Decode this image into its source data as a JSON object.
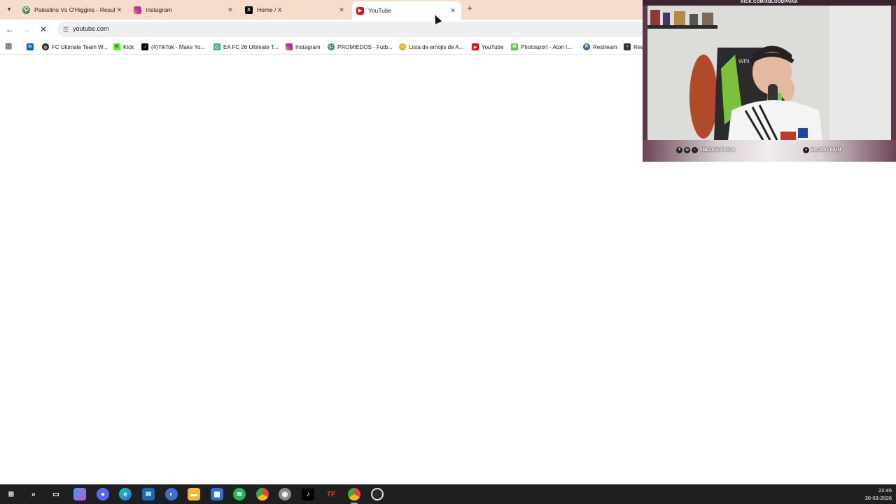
{
  "colors": {
    "tabstrip_bg": "#f7dccc",
    "taskbar_bg": "#1f1f1f",
    "accent": "#60aaff"
  },
  "tabs": [
    {
      "title": "Palestino Vs O'Higgins - Resulta",
      "icon": "soccer-ball-icon",
      "active": false
    },
    {
      "title": "Instagram",
      "icon": "instagram-icon",
      "active": false
    },
    {
      "title": "Home / X",
      "icon": "x-logo-icon",
      "active": false
    },
    {
      "title": "YouTube",
      "icon": "youtube-icon",
      "active": true
    }
  ],
  "tab_close_glyph": "✕",
  "new_tab_glyph": "+",
  "address": {
    "url": "youtube.com"
  },
  "bookmarks": [
    {
      "label": "",
      "icon": "linkedin-icon"
    },
    {
      "label": "FC Ultimate Team W...",
      "icon": "fc-icon"
    },
    {
      "label": "Kick",
      "icon": "kick-icon"
    },
    {
      "label": "(4)TikTok - Make Yo...",
      "icon": "tiktok-icon"
    },
    {
      "label": "EA FC 26 Ultimate T...",
      "icon": "ea-icon"
    },
    {
      "label": "Instagram",
      "icon": "instagram-icon"
    },
    {
      "label": "PROMIEDOS - Futb...",
      "icon": "promiedos-icon"
    },
    {
      "label": "Lista de emojis de A...",
      "icon": "emoji-icon"
    },
    {
      "label": "YouTube",
      "icon": "youtube-icon"
    },
    {
      "label": "Photosport - Aton I...",
      "icon": "photosport-icon"
    },
    {
      "label": "Restream",
      "icon": "restream-icon"
    },
    {
      "label": "Res",
      "icon": "bookmark-icon"
    }
  ],
  "webcam": {
    "channel_url": "KICK.COM/XBLOODPAINX",
    "handle_left": "XBLOODPAINX",
    "handle_right": "BLOOD PAIN"
  },
  "taskbar": {
    "icons": [
      "windows-start-icon",
      "search-icon",
      "task-view-icon",
      "copilot-icon",
      "discord-icon",
      "edge-icon",
      "mail-icon",
      "app-icon",
      "file-explorer-icon",
      "store-icon",
      "spotify-icon",
      "chrome-icon",
      "app-icon",
      "tiktok-icon",
      "tf-icon",
      "chrome-icon",
      "obs-icon"
    ],
    "time": "22:45",
    "date": "30-03-2026"
  }
}
